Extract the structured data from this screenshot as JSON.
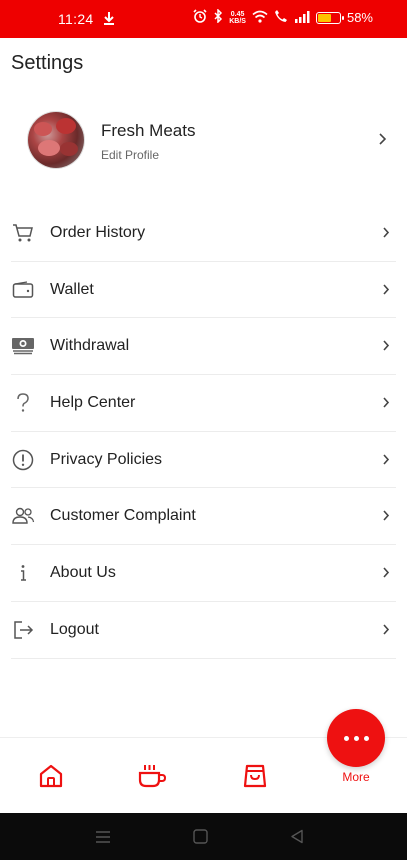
{
  "status_bar": {
    "time": "11:24",
    "speed_value": "0.45",
    "speed_unit": "KB/S",
    "battery": "58%",
    "battery_level": 0.58,
    "background": "#ee0000"
  },
  "page": {
    "title": "Settings"
  },
  "profile": {
    "name": "Fresh Meats",
    "subtitle": "Edit Profile"
  },
  "menu": [
    {
      "label": "Order History",
      "icon": "cart-icon"
    },
    {
      "label": "Wallet",
      "icon": "wallet-icon"
    },
    {
      "label": "Withdrawal",
      "icon": "cash-icon"
    },
    {
      "label": "Help Center",
      "icon": "question-icon"
    },
    {
      "label": "Privacy Policies",
      "icon": "alert-circle-icon"
    },
    {
      "label": "Customer Complaint",
      "icon": "users-icon"
    },
    {
      "label": "About Us",
      "icon": "info-icon"
    },
    {
      "label": "Logout",
      "icon": "logout-icon"
    }
  ],
  "bottom_nav": {
    "items": [
      {
        "icon": "home-icon"
      },
      {
        "icon": "coffee-cup-icon"
      },
      {
        "icon": "shopping-bag-icon"
      }
    ],
    "more_label": "More",
    "accent": "#ee1111"
  },
  "system_nav": {
    "icons": [
      "menu-icon",
      "square-icon",
      "back-triangle-icon"
    ]
  }
}
